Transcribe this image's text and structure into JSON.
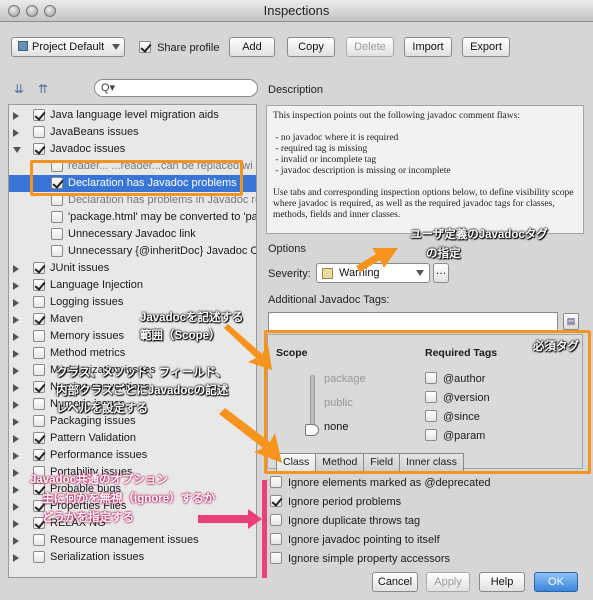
{
  "window": {
    "title": "Inspections"
  },
  "toolbar": {
    "profile": "Project Default",
    "share_profile_label": "Share profile",
    "add": "Add",
    "copy": "Copy",
    "delete": "Delete",
    "import": "Import",
    "export": "Export"
  },
  "search": {
    "placeholder": "Q▾"
  },
  "tree": {
    "items": [
      {
        "label": "Java language level migration aids",
        "checked": true
      },
      {
        "label": "JavaBeans issues",
        "checked": false
      },
      {
        "label": "Javadoc issues",
        "checked": true,
        "expanded": true
      },
      {
        "label": "reader... ...reader...can be replaced wi",
        "checked": false,
        "child": true,
        "faded": true
      },
      {
        "label": "Declaration has Javadoc problems",
        "checked": true,
        "child": true,
        "selected": true
      },
      {
        "label": "Declaration has problems in Javadoc ref",
        "checked": false,
        "child": true,
        "faded": true
      },
      {
        "label": "'package.html' may be converted to 'pa",
        "checked": false,
        "child": true
      },
      {
        "label": "Unnecessary Javadoc link",
        "checked": false,
        "child": true
      },
      {
        "label": "Unnecessary {@inheritDoc} Javadoc Co",
        "checked": false,
        "child": true
      },
      {
        "label": "JUnit issues",
        "checked": true
      },
      {
        "label": "Language Injection",
        "checked": true
      },
      {
        "label": "Logging issues",
        "checked": false
      },
      {
        "label": "Maven",
        "checked": true
      },
      {
        "label": "Memory issues",
        "checked": false
      },
      {
        "label": "Method metrics",
        "checked": false
      },
      {
        "label": "Modularization issues",
        "checked": false
      },
      {
        "label": "Naming conventions",
        "checked": true
      },
      {
        "label": "Numeric issues",
        "checked": false
      },
      {
        "label": "Packaging issues",
        "checked": false
      },
      {
        "label": "Pattern Validation",
        "checked": true
      },
      {
        "label": "Performance issues",
        "checked": true
      },
      {
        "label": "Portability issues",
        "checked": false
      },
      {
        "label": "Probable bugs",
        "checked": true
      },
      {
        "label": "Properties Files",
        "checked": true
      },
      {
        "label": "RELAX NG",
        "checked": true
      },
      {
        "label": "Resource management issues",
        "checked": false
      },
      {
        "label": "Serialization issues",
        "checked": false
      }
    ]
  },
  "description": {
    "header": "Description",
    "text": "This inspection points out the following javadoc comment flaws:\n\n - no javadoc where it is required\n - required tag is missing\n - invalid or incomplete tag\n - javadoc description is missing or incomplete\n\nUse tabs and corresponding inspection options below, to define visibility scope where javadoc is required, as well as the required javadoc tags for classes, methods, fields and inner classes."
  },
  "options": {
    "header": "Options",
    "severity_label": "Severity:",
    "severity_value": "Warning",
    "severity_color": "#e8dca0",
    "additional_tags_label": "Additional Javadoc Tags:",
    "scope_label": "Scope",
    "scope_levels": [
      "package",
      "public",
      "none"
    ],
    "scope_selected": "none",
    "required_tags_label": "Required Tags",
    "required_tags": [
      "@author",
      "@version",
      "@since",
      "@param"
    ],
    "tabs": [
      "Class",
      "Method",
      "Field",
      "Inner class"
    ],
    "active_tab": "Class",
    "checks": [
      {
        "label": "Ignore elements marked as @deprecated",
        "checked": false
      },
      {
        "label": "Ignore period problems",
        "checked": true
      },
      {
        "label": "Ignore duplicate throws tag",
        "checked": false
      },
      {
        "label": "Ignore javadoc pointing to itself",
        "checked": false
      },
      {
        "label": "Ignore simple property accessors",
        "checked": false
      }
    ]
  },
  "footer": {
    "cancel": "Cancel",
    "apply": "Apply",
    "help": "Help",
    "ok": "OK"
  },
  "annotations": {
    "user_tags_1": "ユーザ定義のJavadocタグ",
    "user_tags_2": "の指定",
    "scope_1": "Javadocを記述する",
    "scope_2": "範囲（Scope）",
    "required": "必須タグ",
    "levels_1": "クラス、メソッド、フィールド、",
    "levels_2": "内部クラスごとにJavadocの記述",
    "levels_3": "レベルを設定する",
    "common_1": "Javadoc共通のオプション",
    "common_2": "主に何かを無視（ignore）するか",
    "common_3": "どうかを指定する",
    "colors": {
      "orange": "#f6941d",
      "pink": "#ef3f7a"
    }
  }
}
